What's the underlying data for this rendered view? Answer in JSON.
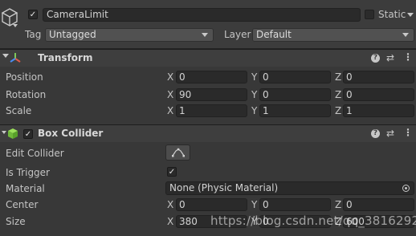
{
  "header": {
    "object_name": "CameraLimit",
    "static_label": "Static",
    "tag_label": "Tag",
    "tag_value": "Untagged",
    "layer_label": "Layer",
    "layer_value": "Default"
  },
  "transform": {
    "title": "Transform",
    "rows": [
      {
        "label": "Position",
        "x": "0",
        "y": "0",
        "z": "0"
      },
      {
        "label": "Rotation",
        "x": "90",
        "y": "0",
        "z": "0"
      },
      {
        "label": "Scale",
        "x": "1",
        "y": "1",
        "z": "1"
      }
    ]
  },
  "box_collider": {
    "title": "Box Collider",
    "edit_collider_label": "Edit Collider",
    "is_trigger_label": "Is Trigger",
    "material_label": "Material",
    "material_value": "None (Physic Material)",
    "center": {
      "label": "Center",
      "x": "0",
      "y": "0",
      "z": "0"
    },
    "size": {
      "label": "Size",
      "x": "380",
      "y": "0",
      "z": "600"
    }
  },
  "axes": {
    "x": "X",
    "y": "Y",
    "z": "Z"
  },
  "watermark": "https://blog.csdn.net/qq_38162926"
}
